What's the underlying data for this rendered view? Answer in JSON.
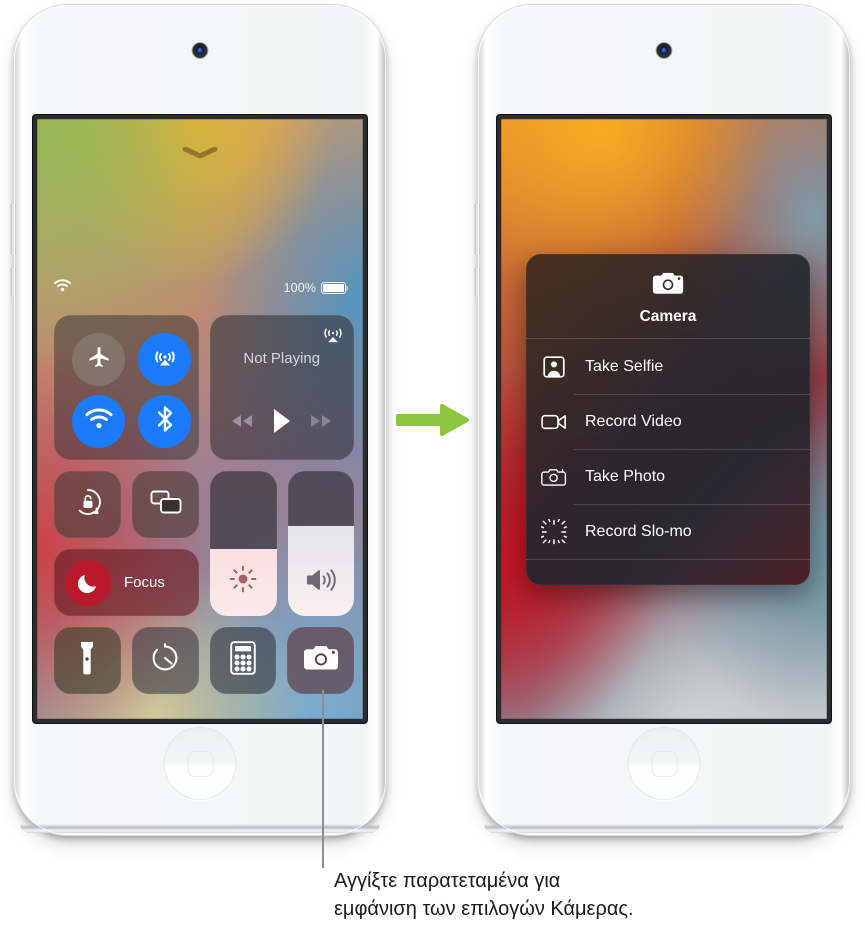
{
  "left_device": {
    "name": "ipod-touch-control-center",
    "screen": {
      "grab_handle": "chevron-down-handle",
      "status_bar": {
        "wifi_icon": "wifi-icon",
        "battery_percent": "100%",
        "battery_icon": "battery-full-icon"
      },
      "connectivity": {
        "airplane_mode": {
          "icon": "airplane-icon",
          "state": "off"
        },
        "airdrop": {
          "icon": "airdrop-icon",
          "state": "on"
        },
        "wifi": {
          "icon": "wifi-icon",
          "state": "on"
        },
        "bluetooth": {
          "icon": "bluetooth-icon",
          "state": "on"
        }
      },
      "media": {
        "title": "Not Playing",
        "airplay_icon": "airplay-audio-icon",
        "rewind_icon": "rewind-icon",
        "play_icon": "play-icon",
        "forward_icon": "fast-forward-icon"
      },
      "tiles": {
        "rotation_lock": "rotation-lock-icon",
        "screen_mirroring": "screen-mirroring-icon",
        "focus_label": "Focus",
        "focus_icon": "moon-icon",
        "brightness_icon": "brightness-icon",
        "volume_icon": "volume-icon",
        "flashlight": "flashlight-icon",
        "timer": "timer-icon",
        "calculator": "calculator-icon",
        "camera": "camera-icon"
      }
    }
  },
  "right_device": {
    "name": "ipod-touch-camera-quick-actions",
    "context_menu": {
      "header_icon": "camera-icon",
      "title": "Camera",
      "items": [
        {
          "label": "Take Selfie",
          "icon": "portrait-icon"
        },
        {
          "label": "Record Video",
          "icon": "video-camera-icon"
        },
        {
          "label": "Take Photo",
          "icon": "camera-outline-icon"
        },
        {
          "label": "Record Slo-mo",
          "icon": "slow-motion-icon"
        }
      ]
    }
  },
  "arrow": {
    "name": "green-right-arrow",
    "color": "#8CC63E"
  },
  "caption": {
    "line1": "Αγγίξτε παρατεταμένα για",
    "line2": "εμφάνιση των επιλογών Κάμερας."
  }
}
